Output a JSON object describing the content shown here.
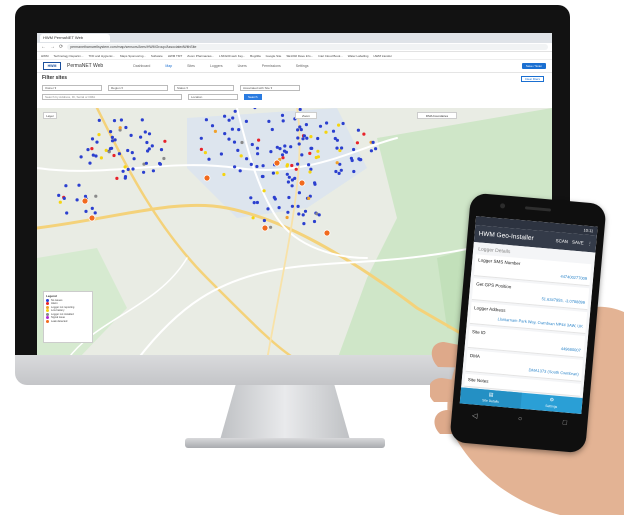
{
  "browser": {
    "tab_title": "HWM PermaNET Web",
    "url": "permanetharnwellsystem.com/map/sensors/Ares/HWMGroup/AssociatedWithSite",
    "bookmarks": [
      "HWM",
      "Technology Departm...",
      "TFD and Hygienic...",
      "Maps Sponsoring...",
      "Software",
      "HWM TMT",
      "Zoom Pharmacies...",
      "LNKG00 web Key...",
      "Bugzilla",
      "Google Site",
      "SE1302 Dave Info...",
      "Intel Cloud Book...",
      "Water Labelling",
      "HWM transfer"
    ]
  },
  "app": {
    "logo": "HWM",
    "name": "PermaNET Web",
    "nav": [
      "Dashboard",
      "Map",
      "Sites",
      "Loggers",
      "Users",
      "Permissions",
      "Settings"
    ],
    "active_nav": "Map",
    "header_button": "Save / Scan"
  },
  "filters": {
    "title": "Filter sites",
    "reset": "Clear filters",
    "selects": [
      "Owner",
      "Region",
      "Status",
      "Associated with Site"
    ],
    "search_placeholder": "Search by Address, ID, Serial or DMA",
    "second_select": "Location",
    "locate_button": "Search"
  },
  "map": {
    "layer_ctrl": "Layer",
    "zoom_ctrl": "Zoom",
    "dropdown": "DMA boundaries",
    "legend_title": "Legend",
    "legend": [
      {
        "label": "No issues",
        "color": "#2b3fcf"
      },
      {
        "label": "Alarm",
        "color": "#e8222a"
      },
      {
        "label": "Logger not reporting",
        "color": "#f0a12b"
      },
      {
        "label": "Low battery",
        "color": "#f5d40f"
      },
      {
        "label": "Logger not installed",
        "color": "#8a8a8a"
      },
      {
        "label": "Signal issue",
        "color": "#b02ad1"
      },
      {
        "label": "Leak detected",
        "color": "#f16a1e"
      }
    ]
  },
  "phone": {
    "status": "10:11",
    "app_title": "HWM Geo-Installer",
    "actions": [
      "SCAN",
      "SAVE",
      "⋮"
    ],
    "section": "Logger Details",
    "fields": [
      {
        "label": "Logger SMS Number",
        "value": "447400277009"
      },
      {
        "label": "Get GPS Position",
        "value": "51.6347955, -3.0788899"
      },
      {
        "label": "Logger Address",
        "value": "Llantarnam Park Way, Cwmbran NP44 3AW, UK"
      },
      {
        "label": "Site ID",
        "value": "449680007"
      },
      {
        "label": "DMA",
        "value": "DMA1373 (South Cwmbran)"
      },
      {
        "label": "Site Notes",
        "value": ""
      }
    ],
    "bottom_nav": [
      {
        "label": "Site Details",
        "icon": "▤"
      },
      {
        "label": "Settings",
        "icon": "⚙"
      }
    ]
  }
}
